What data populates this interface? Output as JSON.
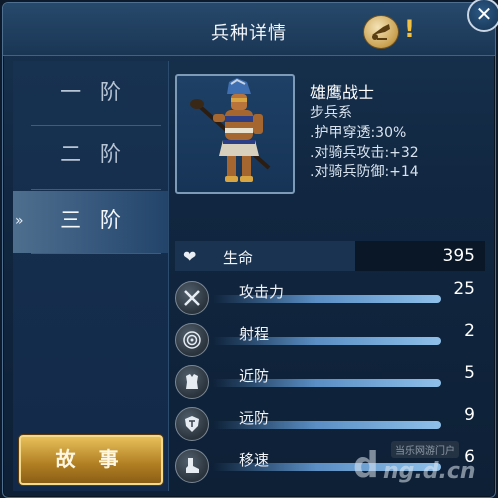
{
  "header": {
    "title": "兵种详情",
    "help_mark": "!",
    "close_glyph": "✕"
  },
  "tabs": [
    {
      "label": "一 阶",
      "active": false
    },
    {
      "label": "二 阶",
      "active": false
    },
    {
      "label": "三 阶",
      "active": true
    }
  ],
  "story_button": "故 事",
  "unit": {
    "name": "雄鹰战士",
    "type": "步兵系",
    "bonuses": [
      ".护甲穿透:30%",
      ".对骑兵攻击:+32",
      ".对骑兵防御:+14"
    ]
  },
  "stats": {
    "hp": {
      "label": "生命",
      "value": "395",
      "icon": "heart-icon"
    },
    "rows": [
      {
        "label": "攻击力",
        "value": "25",
        "icon": "crossed-swords-icon"
      },
      {
        "label": "射程",
        "value": "2",
        "icon": "target-icon"
      },
      {
        "label": "近防",
        "value": "5",
        "icon": "armor-icon"
      },
      {
        "label": "远防",
        "value": "9",
        "icon": "shield-icon"
      },
      {
        "label": "移速",
        "value": "6",
        "icon": "boot-icon"
      }
    ]
  },
  "watermark": {
    "top": "当乐网游门户",
    "main": "ng.d.cn"
  },
  "colors": {
    "panel": "#112640",
    "accent_gold": "#c9a04f",
    "bar_blue": "#8fc0ea"
  }
}
